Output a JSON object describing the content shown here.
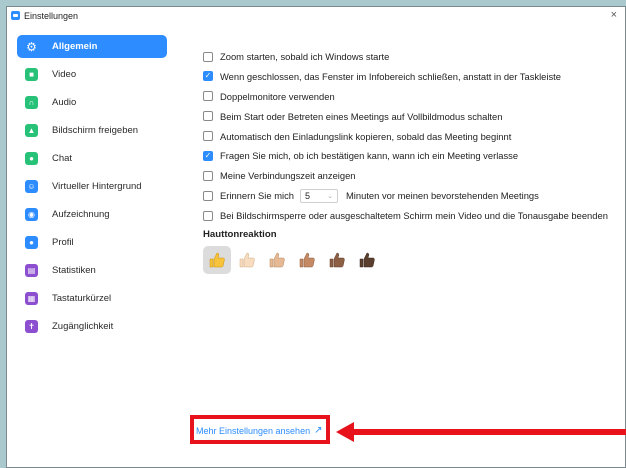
{
  "window": {
    "title": "Einstellungen",
    "close_glyph": "×"
  },
  "sidebar": {
    "items": [
      {
        "label": "Allgemein",
        "icon": "gear-icon",
        "color": "#2d8cff",
        "active": true
      },
      {
        "label": "Video",
        "icon": "video-camera-icon",
        "color": "#27c278"
      },
      {
        "label": "Audio",
        "icon": "headphones-icon",
        "color": "#27c278"
      },
      {
        "label": "Bildschirm freigeben",
        "icon": "share-screen-icon",
        "color": "#27c278"
      },
      {
        "label": "Chat",
        "icon": "chat-bubble-icon",
        "color": "#27c278"
      },
      {
        "label": "Virtueller Hintergrund",
        "icon": "virtual-background-icon",
        "color": "#2d8cff"
      },
      {
        "label": "Aufzeichnung",
        "icon": "record-icon",
        "color": "#2d8cff"
      },
      {
        "label": "Profil",
        "icon": "profile-icon",
        "color": "#2d8cff"
      },
      {
        "label": "Statistiken",
        "icon": "statistics-icon",
        "color": "#8c4fd0"
      },
      {
        "label": "Tastaturkürzel",
        "icon": "keyboard-icon",
        "color": "#8c4fd0"
      },
      {
        "label": "Zugänglichkeit",
        "icon": "accessibility-icon",
        "color": "#8c4fd0"
      }
    ]
  },
  "options": [
    {
      "label": "Zoom starten, sobald ich Windows starte",
      "checked": false
    },
    {
      "label": "Wenn geschlossen, das Fenster im Infobereich schließen, anstatt in der Taskleiste",
      "checked": true
    },
    {
      "label": "Doppelmonitore verwenden",
      "checked": false
    },
    {
      "label": "Beim Start oder Betreten eines Meetings auf Vollbildmodus schalten",
      "checked": false
    },
    {
      "label": "Automatisch den Einladungslink kopieren, sobald das Meeting beginnt",
      "checked": false
    },
    {
      "label": "Fragen Sie mich, ob ich bestätigen kann, wann ich ein Meeting verlasse",
      "checked": true
    },
    {
      "label": "Meine Verbindungszeit anzeigen",
      "checked": false
    }
  ],
  "reminder": {
    "label_before": "Erinnern Sie mich",
    "minutes": "5",
    "label_after": "Minuten vor meinen bevorstehenden Meetings",
    "checked": false
  },
  "screen_lock": {
    "label": "Bei Bildschirmsperre oder ausgeschaltetem Schirm mein Video und die Tonausgabe beenden",
    "checked": false
  },
  "skin_tone": {
    "title": "Hauttonreaktion",
    "selected_index": 0,
    "tones": [
      "#f8c33c",
      "#f7dcc0",
      "#e6b995",
      "#c38a64",
      "#8d5f45",
      "#5a3e2e"
    ]
  },
  "more_settings": {
    "label": "Mehr Einstellungen ansehen",
    "icon": "external-link-icon"
  },
  "annotation": {
    "color": "#e8121d"
  }
}
